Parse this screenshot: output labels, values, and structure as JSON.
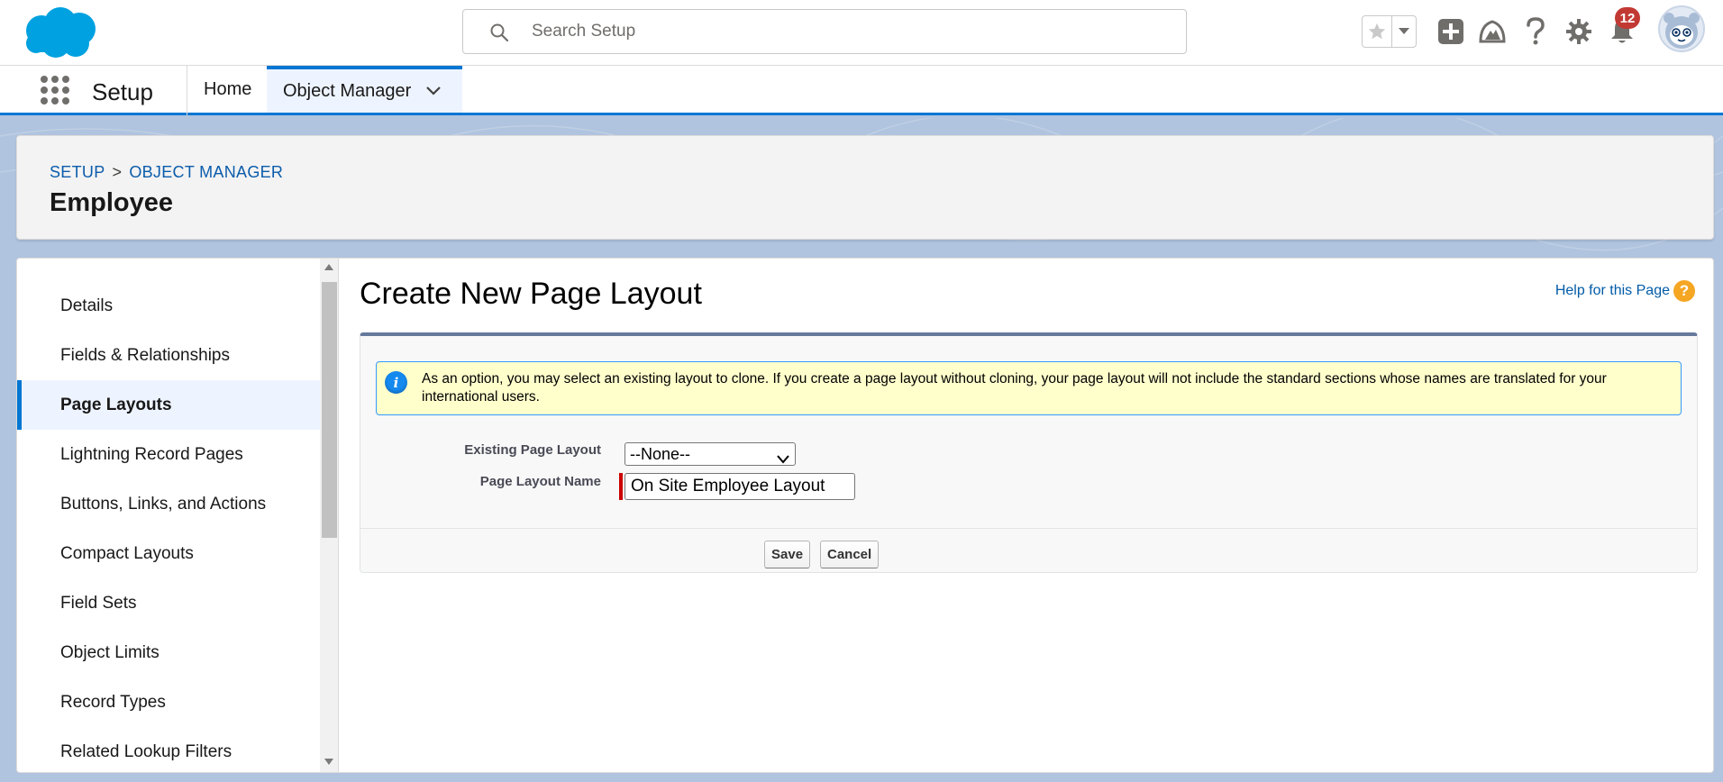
{
  "global_header": {
    "search": {
      "placeholder": "Search Setup",
      "value": ""
    },
    "notifications": {
      "count": "12"
    },
    "icons": [
      "salesforce-cloud-logo",
      "search-icon",
      "favorite-star-icon",
      "chevron-down-icon",
      "global-actions-plus-icon",
      "trailhead-icon",
      "help-question-icon",
      "setup-gear-icon",
      "notification-bell-icon",
      "user-avatar"
    ]
  },
  "context_bar": {
    "app_name": "Setup",
    "nav": [
      {
        "label": "Home",
        "active": false
      },
      {
        "label": "Object Manager",
        "active": true
      }
    ]
  },
  "page_header": {
    "breadcrumb": [
      "SETUP",
      "OBJECT MANAGER"
    ],
    "breadcrumb_sep": ">",
    "title": "Employee"
  },
  "sidebar": {
    "items": [
      {
        "label": "Details",
        "active": false
      },
      {
        "label": "Fields & Relationships",
        "active": false
      },
      {
        "label": "Page Layouts",
        "active": true
      },
      {
        "label": "Lightning Record Pages",
        "active": false
      },
      {
        "label": "Buttons, Links, and Actions",
        "active": false
      },
      {
        "label": "Compact Layouts",
        "active": false
      },
      {
        "label": "Field Sets",
        "active": false
      },
      {
        "label": "Object Limits",
        "active": false
      },
      {
        "label": "Record Types",
        "active": false
      },
      {
        "label": "Related Lookup Filters",
        "active": false
      }
    ]
  },
  "content": {
    "title": "Create New Page Layout",
    "help_link": "Help for this Page",
    "info_message": "As an option, you may select an existing layout to clone. If you create a page layout without cloning, your page layout will not include the standard sections whose names are translated for your international users.",
    "existing_layout_label": "Existing Page Layout",
    "existing_layout_value": "--None--",
    "layout_name_label": "Page Layout Name",
    "layout_name_value": "On Site Employee Layout",
    "save_label": "Save",
    "cancel_label": "Cancel"
  },
  "colors": {
    "brand_blue": "#0176d3",
    "salesforce_cloud": "#00a1e0",
    "notification_red": "#c23934",
    "info_background": "#ffffcc",
    "help_orange": "#f5a623"
  }
}
